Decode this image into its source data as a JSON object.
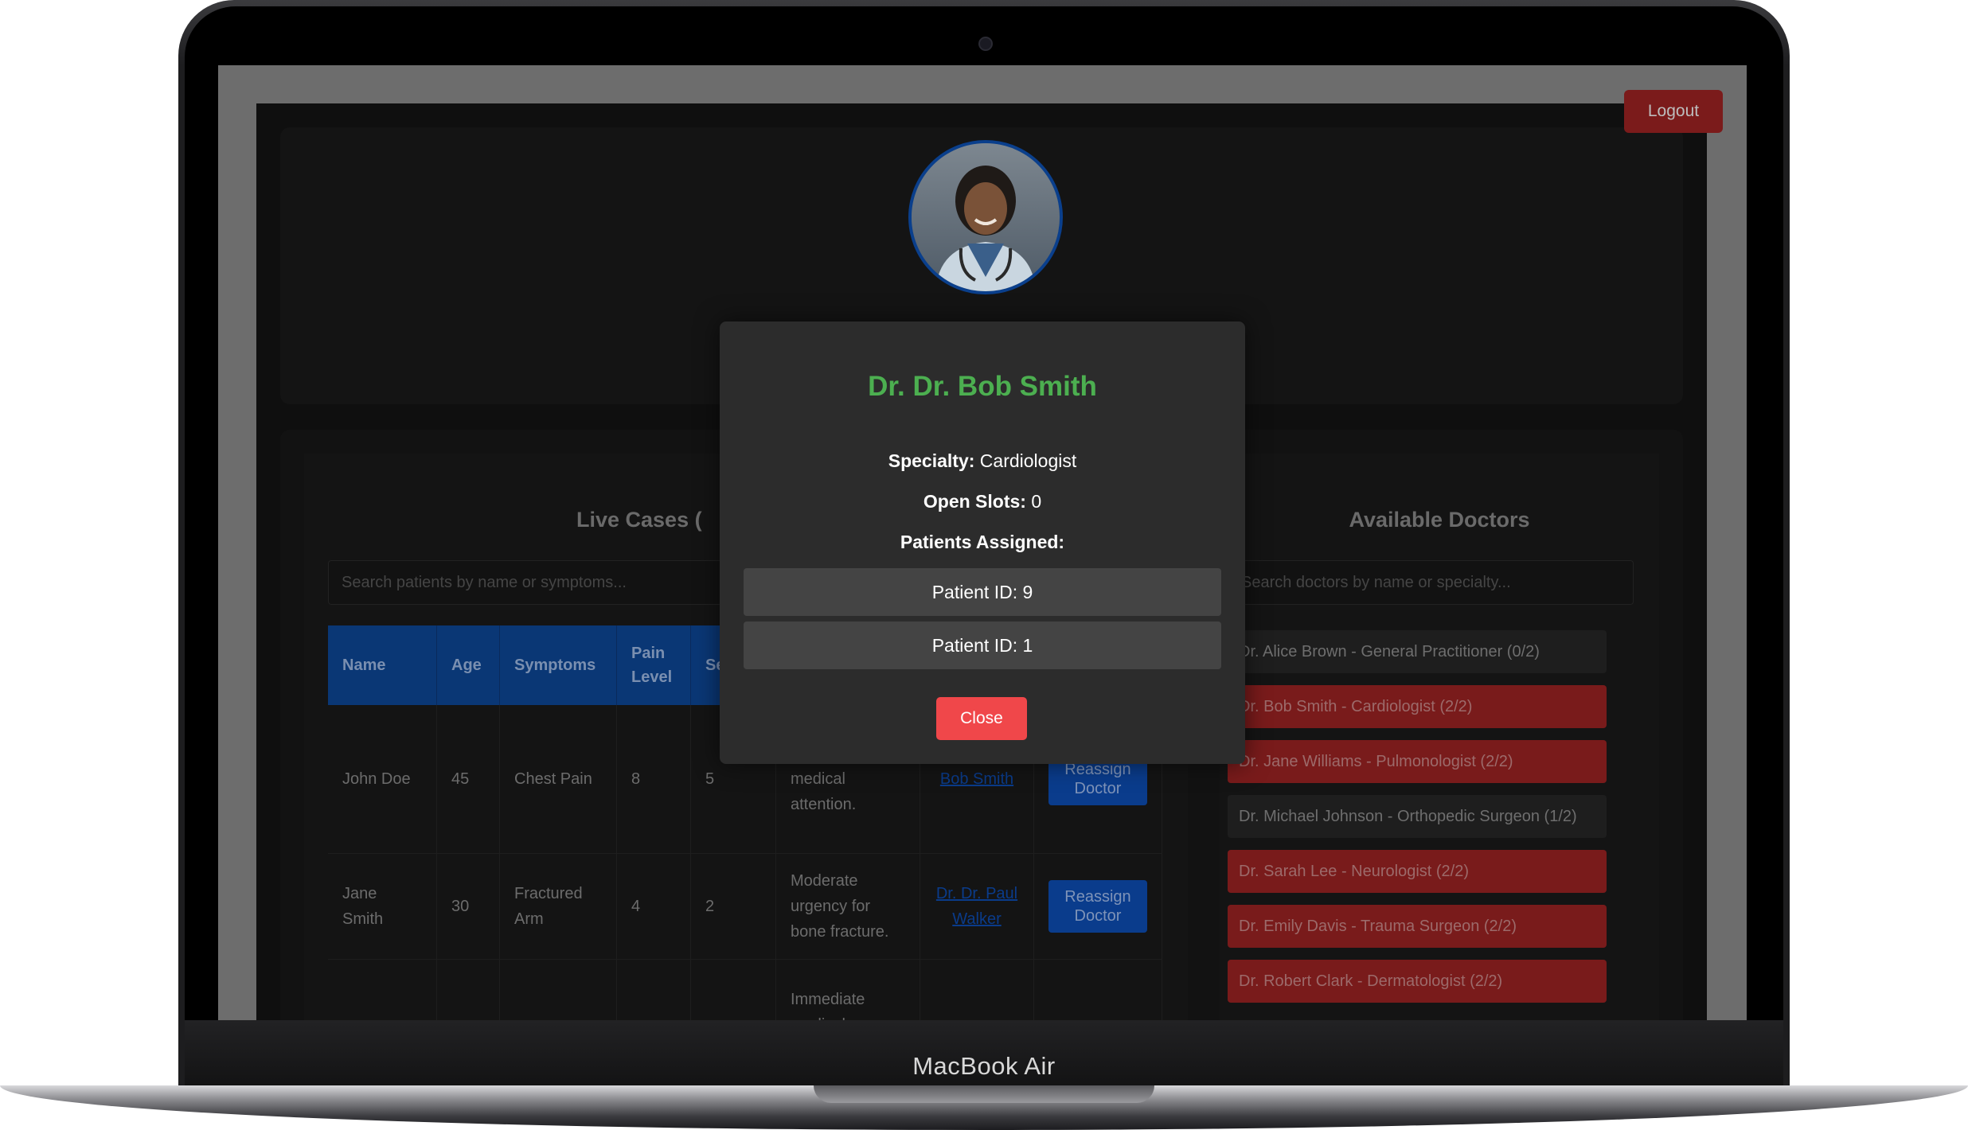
{
  "device": {
    "brand": "MacBook Air"
  },
  "header": {
    "logout_label": "Logout"
  },
  "live_cases": {
    "title": "Live Cases (",
    "search_placeholder": "Search patients by name or symptoms...",
    "columns": [
      "Name",
      "Age",
      "Symptoms",
      "Pain Level",
      "Se"
    ],
    "rows": [
      {
        "name": "John Doe",
        "age": "45",
        "symptoms": "Chest Pain",
        "pain": "8",
        "severity": "5",
        "notes": "immediate medical attention.",
        "doctor": "Bob Smith",
        "action": "Reassign Doctor"
      },
      {
        "name": "Jane Smith",
        "age": "30",
        "symptoms": "Fractured Arm",
        "pain": "4",
        "severity": "2",
        "notes": "Moderate urgency for bone fracture.",
        "doctor": "Dr. Dr. Paul Walker",
        "action": "Reassign Doctor"
      },
      {
        "notes": "Immediate medical"
      }
    ]
  },
  "available_doctors": {
    "title": "Available Doctors",
    "search_placeholder": "Search doctors by name or specialty...",
    "items": [
      {
        "label": "Dr. Alice Brown - General Practitioner (0/2)",
        "full": false
      },
      {
        "label": "Dr. Bob Smith - Cardiologist (2/2)",
        "full": true
      },
      {
        "label": "Dr. Jane Williams - Pulmonologist (2/2)",
        "full": true
      },
      {
        "label": "Dr. Michael Johnson - Orthopedic Surgeon (1/2)",
        "full": false
      },
      {
        "label": "Dr. Sarah Lee - Neurologist (2/2)",
        "full": true
      },
      {
        "label": "Dr. Emily Davis - Trauma Surgeon (2/2)",
        "full": true
      },
      {
        "label": "Dr. Robert Clark - Dermatologist (2/2)",
        "full": true
      }
    ]
  },
  "modal": {
    "title": "Dr. Dr. Bob Smith",
    "specialty_label": "Specialty:",
    "specialty_value": "Cardiologist",
    "slots_label": "Open Slots:",
    "slots_value": "0",
    "patients_label": "Patients Assigned:",
    "patients": [
      "Patient ID: 9",
      "Patient ID: 1"
    ],
    "close_label": "Close"
  },
  "colors": {
    "doctor_name": "#4caf50",
    "close_button": "#f0474a",
    "full_doctor": "#791b1b",
    "table_header": "#0a3775"
  }
}
